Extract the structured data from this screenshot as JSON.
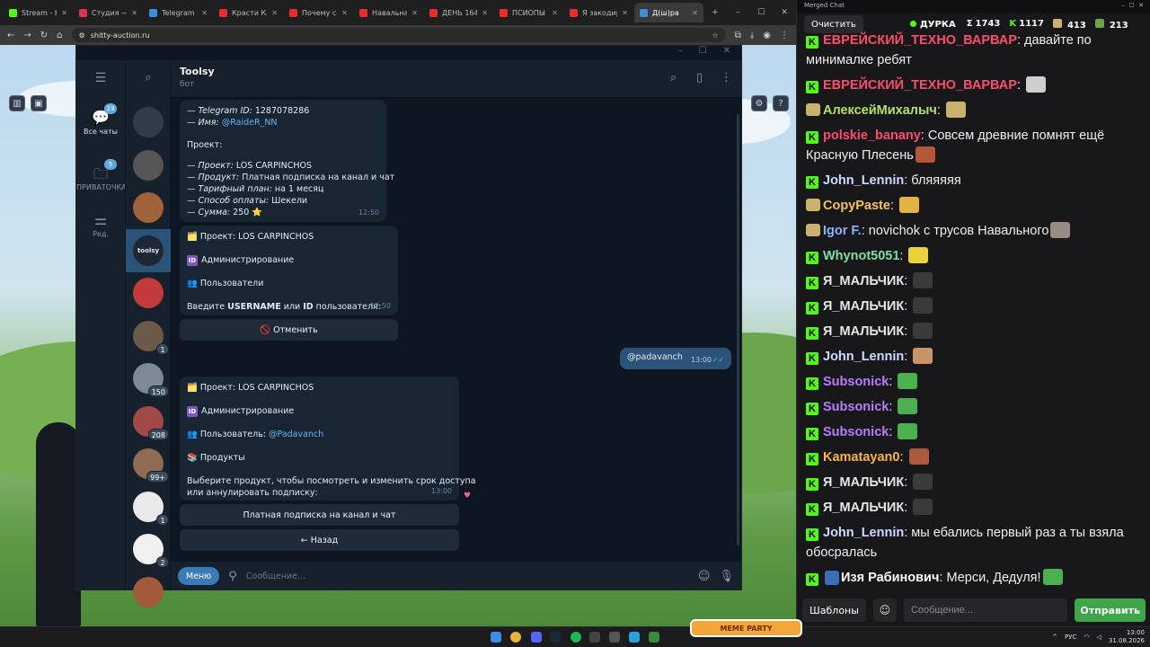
{
  "browser": {
    "tabs": [
      {
        "label": "Stream - Kick ",
        "color": "#53fc18",
        "active": false
      },
      {
        "label": "Студия — VK ",
        "color": "#d23a4a",
        "active": false
      },
      {
        "label": "Telegram Web",
        "color": "#3b8de0",
        "active": false
      },
      {
        "label": "Красти Краб ",
        "color": "#e62e2e",
        "active": false
      },
      {
        "label": "Почему самы",
        "color": "#e62e2e",
        "active": false
      },
      {
        "label": "Навальная, Х",
        "color": "#e62e2e",
        "active": false
      },
      {
        "label": "ДЕНЬ 1649. П",
        "color": "#e62e2e",
        "active": false
      },
      {
        "label": "ПСИОПЫ за",
        "color": "#e62e2e",
        "active": false
      },
      {
        "label": "Я закодирова",
        "color": "#e62e2e",
        "active": false
      },
      {
        "label": "Д(ш)ра",
        "color": "#3b8de0",
        "active": true
      }
    ],
    "new_tab": "+",
    "url": "shitty-auction.ru"
  },
  "telegram": {
    "folders": [
      {
        "label": "Все чаты",
        "badge": "23",
        "icon": "chat-bubble-icon",
        "active": true
      },
      {
        "label": "ПРИВАТОЧКА",
        "badge": "5",
        "icon": "folder-icon",
        "active": false
      },
      {
        "label": "Ред.",
        "badge": "",
        "icon": "sliders-icon",
        "active": false
      }
    ],
    "chats": [
      {
        "badge": "",
        "color": "#2f3c4a"
      },
      {
        "badge": "",
        "color": "#555"
      },
      {
        "badge": "",
        "color": "#a0623a"
      },
      {
        "badge": "",
        "color": "#1e2733",
        "selected": true,
        "label": "toolsy"
      },
      {
        "badge": "",
        "color": "#c23b3b"
      },
      {
        "badge": "1",
        "color": "#6b5a4a"
      },
      {
        "badge": "150",
        "color": "#7c8a96"
      },
      {
        "badge": "208",
        "color": "#a14848"
      },
      {
        "badge": "99+",
        "color": "#8e6b52"
      },
      {
        "badge": "1",
        "color": "#e9e9e9"
      },
      {
        "badge": "2",
        "color": "#f0f0f0"
      },
      {
        "badge": "",
        "color": "#a15a3a"
      }
    ],
    "chat_title": "Toolsy",
    "chat_sub": "бот",
    "messages": {
      "m1": {
        "lines": [
          {
            "k": "— Telegram ID:",
            "v": " 1287078286"
          },
          {
            "k": "— Имя:",
            "v": " @RaideR_NN"
          }
        ],
        "project_head": "Проект:",
        "details": [
          {
            "k": "— Проект:",
            "v": " LOS CARPINCHOS"
          },
          {
            "k": "— Продукт:",
            "v": " Платная подписка на канал и чат"
          },
          {
            "k": "— Тарифный план:",
            "v": " на 1 месяц"
          },
          {
            "k": "— Способ оплаты:",
            "v": " Шекели"
          },
          {
            "k": "— Сумма:",
            "v": " 250 ⭐"
          }
        ],
        "time": "12:50"
      },
      "m2": {
        "project": "🗂️ Проект: LOS CARPINCHOS",
        "admin": "Администрирование",
        "users": "👥 Пользователи",
        "prompt_a": "Введите ",
        "prompt_b": "USERNAME",
        "prompt_c": " или ",
        "prompt_d": "ID",
        "prompt_e": " пользователя:",
        "time": "12:50",
        "button": "🚫 Отменить"
      },
      "m3": {
        "text": "@padavanch",
        "time": "13:00"
      },
      "m4": {
        "project": "🗂️ Проект: LOS CARPINCHOS",
        "admin": "Администрирование",
        "user_label": "👥 Пользователь: ",
        "user_link": "@Padavanch",
        "products": "📚 Продукты",
        "prompt1": "Выберите продукт, чтобы посмотреть и изменить срок доступа",
        "prompt2": "или аннулировать подписку:",
        "time": "13:00",
        "btn1": "Платная подписка на канал и чат",
        "btn2": "← Назад"
      }
    },
    "composer": {
      "menu": "Меню",
      "placeholder": "Сообщение..."
    }
  },
  "merged_chat": {
    "window_title": "Merged Chat",
    "clear": "Очистить",
    "channel": "ДУРКА",
    "stats": [
      {
        "icon": "Σ",
        "value": "1743"
      },
      {
        "icon": "K",
        "value": "1117"
      },
      {
        "icon": "",
        "value": "413"
      },
      {
        "icon": "",
        "value": "213"
      }
    ],
    "messages": [
      {
        "platform": "kick",
        "nick": "ЕВРЕЙСКИЙ_ТЕХНО_ВАРВАР",
        "nick_color": "#ff4d6d",
        "text": ": давайте по минималке ребят",
        "emote": ""
      },
      {
        "platform": "kick",
        "nick": "ЕВРЕЙСКИЙ_ТЕХНО_ВАРВАР",
        "nick_color": "#ff4d6d",
        "text": ": ",
        "emote": "#cfcfcf"
      },
      {
        "platform": "yt",
        "nick": "АлексейМихалыч",
        "nick_color": "#b5e06b",
        "text": ": ",
        "emote": "#c9b26b"
      },
      {
        "platform": "kick",
        "nick": "polskie_banany",
        "nick_color": "#ff4d6d",
        "text": ": Совсем древние помнят ещё Красную Плесень",
        "emote": "#b4563a"
      },
      {
        "platform": "kick",
        "nick": "John_Lennin",
        "nick_color": "#cfd8ff",
        "text": ": бляяяяя",
        "emote": ""
      },
      {
        "platform": "yt",
        "nick": "CopyPaste",
        "nick_color": "#f5c15a",
        "text": ": ",
        "emote": "#e3b341"
      },
      {
        "platform": "yt",
        "nick": "Igor F.",
        "nick_color": "#8ab4ff",
        "text": ": novichok с трусов Навального",
        "emote": "#9a8c80"
      },
      {
        "platform": "kick",
        "nick": "Whynot5051",
        "nick_color": "#7ee0a0",
        "text": ": ",
        "emote": "#e8d43a"
      },
      {
        "platform": "kick",
        "nick": "Я_МАЛЬЧИК",
        "nick_color": "#e6e6e6",
        "text": ": ",
        "emote": "#3a3a3a"
      },
      {
        "platform": "kick",
        "nick": "Я_МАЛЬЧИК",
        "nick_color": "#e6e6e6",
        "text": ": ",
        "emote": "#3a3a3a"
      },
      {
        "platform": "kick",
        "nick": "Я_МАЛЬЧИК",
        "nick_color": "#e6e6e6",
        "text": ": ",
        "emote": "#3a3a3a"
      },
      {
        "platform": "kick",
        "nick": "John_Lennin",
        "nick_color": "#cfd8ff",
        "text": ": ",
        "emote": "#c8946a"
      },
      {
        "platform": "kick",
        "nick": "Subsonick",
        "nick_color": "#b77cff",
        "text": ": ",
        "emote": "#4caf50"
      },
      {
        "platform": "kick",
        "nick": "Subsonick",
        "nick_color": "#b77cff",
        "text": ": ",
        "emote": "#4caf50"
      },
      {
        "platform": "kick",
        "nick": "Subsonick",
        "nick_color": "#b77cff",
        "text": ": ",
        "emote": "#4caf50"
      },
      {
        "platform": "kick",
        "nick": "Kamatayan0",
        "nick_color": "#ffb347",
        "text": ": ",
        "emote": "#a85a3a"
      },
      {
        "platform": "kick",
        "nick": "Я_МАЛЬЧИК",
        "nick_color": "#e6e6e6",
        "text": ": ",
        "emote": "#3a3a3a"
      },
      {
        "platform": "kick",
        "nick": "Я_МАЛЬЧИК",
        "nick_color": "#e6e6e6",
        "text": ": ",
        "emote": "#3a3a3a"
      },
      {
        "platform": "kick",
        "nick": "John_Lennin",
        "nick_color": "#cfd8ff",
        "text": ": мы ебались первый раз а ты взяла обосралась",
        "emote": ""
      },
      {
        "platform": "kick",
        "nick": "Изя Рабинович",
        "nick_color": "#ffffff",
        "text": ": Мерси, Дедуля!",
        "emote": "#4caf50",
        "pre_emote": "#3b6fb5"
      }
    ],
    "templates": "Шаблоны",
    "placeholder": "Сообщение...",
    "send": "Отправить"
  },
  "taskbar": {
    "lang": "РУС",
    "time": "13:00",
    "date": "31.08.2026",
    "badge": "MEME PARTY"
  }
}
